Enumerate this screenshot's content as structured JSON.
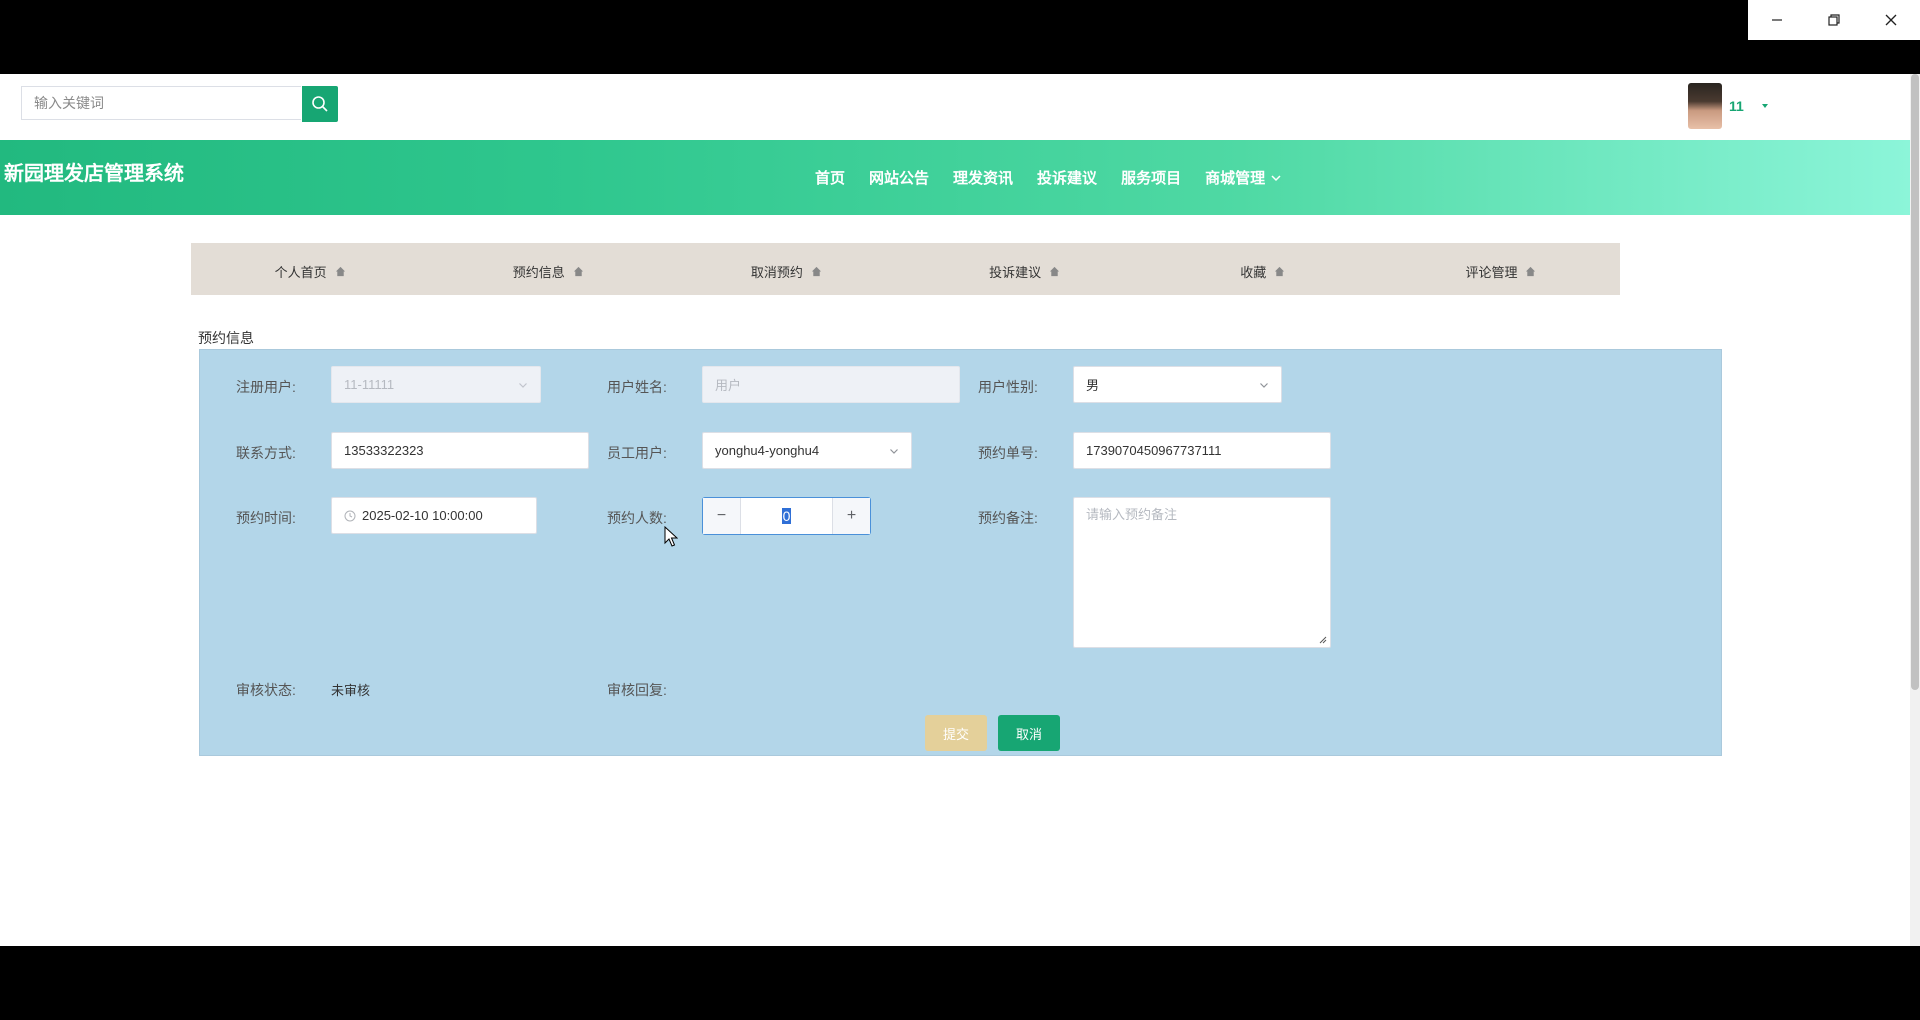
{
  "header": {
    "search_placeholder": "输入关键词",
    "user_name": "11",
    "site_title": "新园理发店管理系统"
  },
  "nav": [
    {
      "label": "首页"
    },
    {
      "label": "网站公告"
    },
    {
      "label": "理发资讯"
    },
    {
      "label": "投诉建议"
    },
    {
      "label": "服务项目"
    },
    {
      "label": "商城管理",
      "dropdown": true
    }
  ],
  "submenu": [
    {
      "label": "个人首页"
    },
    {
      "label": "预约信息"
    },
    {
      "label": "取消预约"
    },
    {
      "label": "投诉建议"
    },
    {
      "label": "收藏"
    },
    {
      "label": "评论管理"
    }
  ],
  "section_title": "预约信息",
  "form": {
    "registered_user_label": "注册用户:",
    "registered_user_value": "11-11111",
    "user_name_label": "用户姓名:",
    "user_name_value": "用户",
    "gender_label": "用户性别:",
    "gender_value": "男",
    "contact_label": "联系方式:",
    "contact_value": "13533322323",
    "staff_label": "员工用户:",
    "staff_value": "yonghu4-yonghu4",
    "order_no_label": "预约单号:",
    "order_no_value": "1739070450967737111",
    "time_label": "预约时间:",
    "time_value": "2025-02-10 10:00:00",
    "people_label": "预约人数:",
    "people_value": "0",
    "remark_label": "预约备注:",
    "remark_placeholder": "请输入预约备注",
    "review_status_label": "审核状态:",
    "review_status_value": "未审核",
    "review_reply_label": "审核回复:",
    "submit_label": "提交",
    "cancel_label": "取消"
  },
  "colors": {
    "accent": "#17a673",
    "panel_bg": "#b3d6e9",
    "submenu_bg": "#e3ddd6",
    "submit_bg": "#e4d09a"
  }
}
